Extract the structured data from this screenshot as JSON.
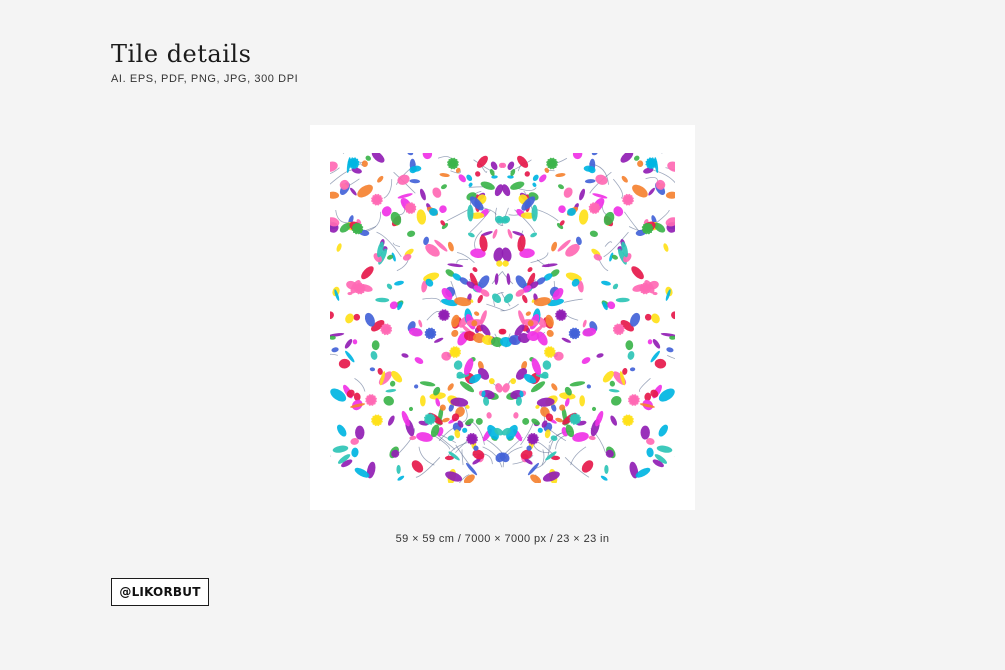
{
  "header": {
    "title": "Tile details",
    "formats": "AI. EPS, PDF, PNG, JPG, 300 DPI"
  },
  "tile": {
    "image_semantic": "otomi-embroidery-pattern",
    "palette": [
      "#e6194b",
      "#f58231",
      "#ffe119",
      "#3cb44b",
      "#00b5e2",
      "#4363d8",
      "#911eb4",
      "#f032e6",
      "#ff69b4",
      "#2ec4b6"
    ]
  },
  "caption": "59 × 59 cm / 7000 × 7000 px / 23 × 23 in",
  "brand": {
    "handle": "@LIKORBUT"
  }
}
